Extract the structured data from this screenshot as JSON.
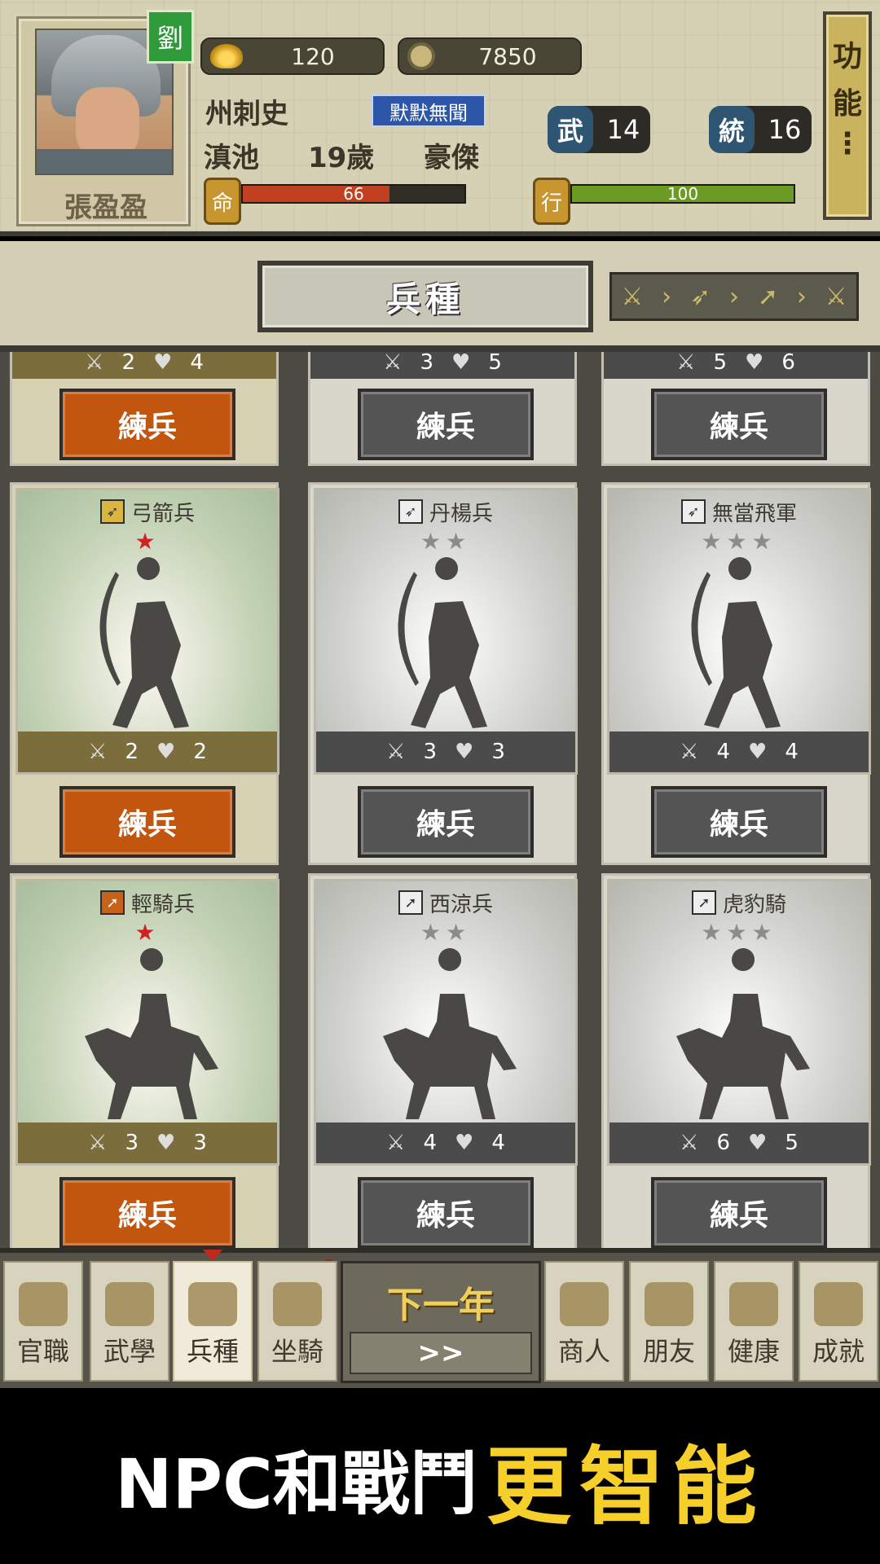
{
  "header": {
    "character_name": "張盈盈",
    "clan": "劉",
    "gold": "120",
    "coins": "7850",
    "office": "州刺史",
    "reputation": "默默無聞",
    "location": "滇池",
    "age": "19歲",
    "trait": "豪傑",
    "stats": [
      {
        "key": "武",
        "value": "14"
      },
      {
        "key": "統",
        "value": "16"
      }
    ],
    "life": {
      "label": "命",
      "value": "66",
      "fraction": 0.66,
      "color": "#c04020"
    },
    "action": {
      "label": "行",
      "value": "100",
      "fraction": 1.0,
      "color": "#6c9b25"
    },
    "function_button": [
      "功",
      "能",
      "⋮"
    ]
  },
  "title_band": {
    "title": "兵種",
    "order_icons": [
      "sword-icon",
      "bow-icon",
      "spear-icon",
      "sword-icon"
    ]
  },
  "grid": {
    "top_row": [
      {
        "attack": "2",
        "defense": "4",
        "button": "練兵",
        "active": true
      },
      {
        "attack": "3",
        "defense": "5",
        "button": "練兵",
        "active": false
      },
      {
        "attack": "5",
        "defense": "6",
        "button": "練兵",
        "active": false
      }
    ],
    "rows": [
      [
        {
          "name": "弓箭兵",
          "stars": 1,
          "attack": "2",
          "defense": "2",
          "button": "練兵",
          "active": true,
          "type_icon": "bow-icon"
        },
        {
          "name": "丹楊兵",
          "stars": 2,
          "attack": "3",
          "defense": "3",
          "button": "練兵",
          "active": false,
          "type_icon": "bow-icon"
        },
        {
          "name": "無當飛軍",
          "stars": 3,
          "attack": "4",
          "defense": "4",
          "button": "練兵",
          "active": false,
          "type_icon": "bow-icon"
        }
      ],
      [
        {
          "name": "輕騎兵",
          "stars": 1,
          "attack": "3",
          "defense": "3",
          "button": "練兵",
          "active": true,
          "type_icon": "spear-icon"
        },
        {
          "name": "西涼兵",
          "stars": 2,
          "attack": "4",
          "defense": "4",
          "button": "練兵",
          "active": false,
          "type_icon": "spear-icon"
        },
        {
          "name": "虎豹騎",
          "stars": 3,
          "attack": "6",
          "defense": "5",
          "button": "練兵",
          "active": false,
          "type_icon": "spear-icon"
        }
      ]
    ]
  },
  "bottom_nav": {
    "items": [
      "官職",
      "武學",
      "兵種",
      "坐騎",
      "商人",
      "朋友",
      "健康",
      "成就"
    ],
    "active": "兵種",
    "next_year": {
      "title": "下一年",
      "button": ">>"
    }
  },
  "banner": {
    "text_white": "NPC和戰鬥",
    "text_yellow": "更智能"
  }
}
